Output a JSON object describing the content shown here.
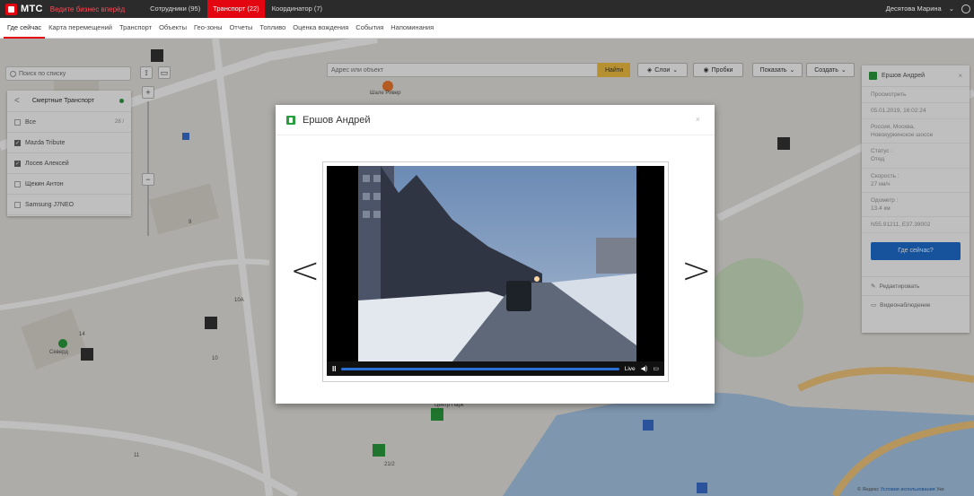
{
  "brand": {
    "logo": "МТС",
    "slogan": "Ведите бизнес вперёд"
  },
  "top_tabs": [
    {
      "label": "Сотрудники (95)",
      "active": false
    },
    {
      "label": "Транспорт (22)",
      "active": true
    },
    {
      "label": "Координатор (7)",
      "active": false
    }
  ],
  "user": {
    "name": "Десятова Марина",
    "chevron": "⌄"
  },
  "nav": [
    "Где сейчас",
    "Карта перемещений",
    "Транспорт",
    "Объекты",
    "Гео-зоны",
    "Отчеты",
    "Топливо",
    "Оценка вождения",
    "События",
    "Напоминания"
  ],
  "left_panel": {
    "search_placeholder": "Поиск по списку",
    "group": "Смертные Транспорт",
    "back": "<",
    "rows": [
      {
        "label": "Все",
        "checked": false,
        "count": "28 /"
      },
      {
        "label": "Mazda Tribute",
        "checked": true,
        "count": ""
      },
      {
        "label": "Лосев Алексей",
        "checked": true,
        "count": ""
      },
      {
        "label": "Щекин Антон",
        "checked": false,
        "count": ""
      },
      {
        "label": "Samsung J7NEO",
        "checked": false,
        "count": ""
      }
    ]
  },
  "map_controls": {
    "plus": "+",
    "minus": "−",
    "address_placeholder": "Адрес или объект",
    "find": "Найти",
    "layers": "Слои",
    "traffic": "Пробки",
    "show": "Показать",
    "create": "Создать",
    "chevron": "⌄"
  },
  "map_labels": {
    "place_1": "Шале Ривер",
    "place_2": "Центр Парк",
    "place_3": "Северд",
    "house_14": "14",
    "house_10": "10",
    "house_10a": "10А",
    "house_11": "11",
    "house_21_2": "21/2",
    "house_9": "9"
  },
  "right_panel": {
    "name": "Ершов Андрей",
    "close": "×",
    "fields": [
      {
        "label": "Просмотреть",
        "value": ""
      },
      {
        "label": "05.01.2019, 16:02:24",
        "value": ""
      },
      {
        "label": "Россия, Москва,",
        "value": "Новокуркинское шоссе"
      },
      {
        "label": "Статус :",
        "value": "Отед"
      },
      {
        "label": "Скорость :",
        "value": "27 км/ч"
      },
      {
        "label": "Одометр :",
        "value": "13.4 км"
      },
      {
        "label": "N55.91211, E37.39002",
        "value": ""
      }
    ],
    "where_button": "Где сейчас?",
    "edit": "Редактировать",
    "video": "Видеонаблюдение"
  },
  "modal": {
    "title": "Ершов Андрей",
    "close": "×",
    "prev": "<",
    "next": ">",
    "player": {
      "pause": "II",
      "live": "Live",
      "volume": "◀)",
      "fullscreen": "▭",
      "progress": 1.0
    }
  },
  "footer": {
    "brand": "© Яндекс",
    "terms": "Условия использования",
    "more": "Уке"
  },
  "colors": {
    "mts_red": "#e30611",
    "green": "#2a9d3c",
    "blue": "#1f6fd0",
    "yellow": "#f5c242"
  }
}
